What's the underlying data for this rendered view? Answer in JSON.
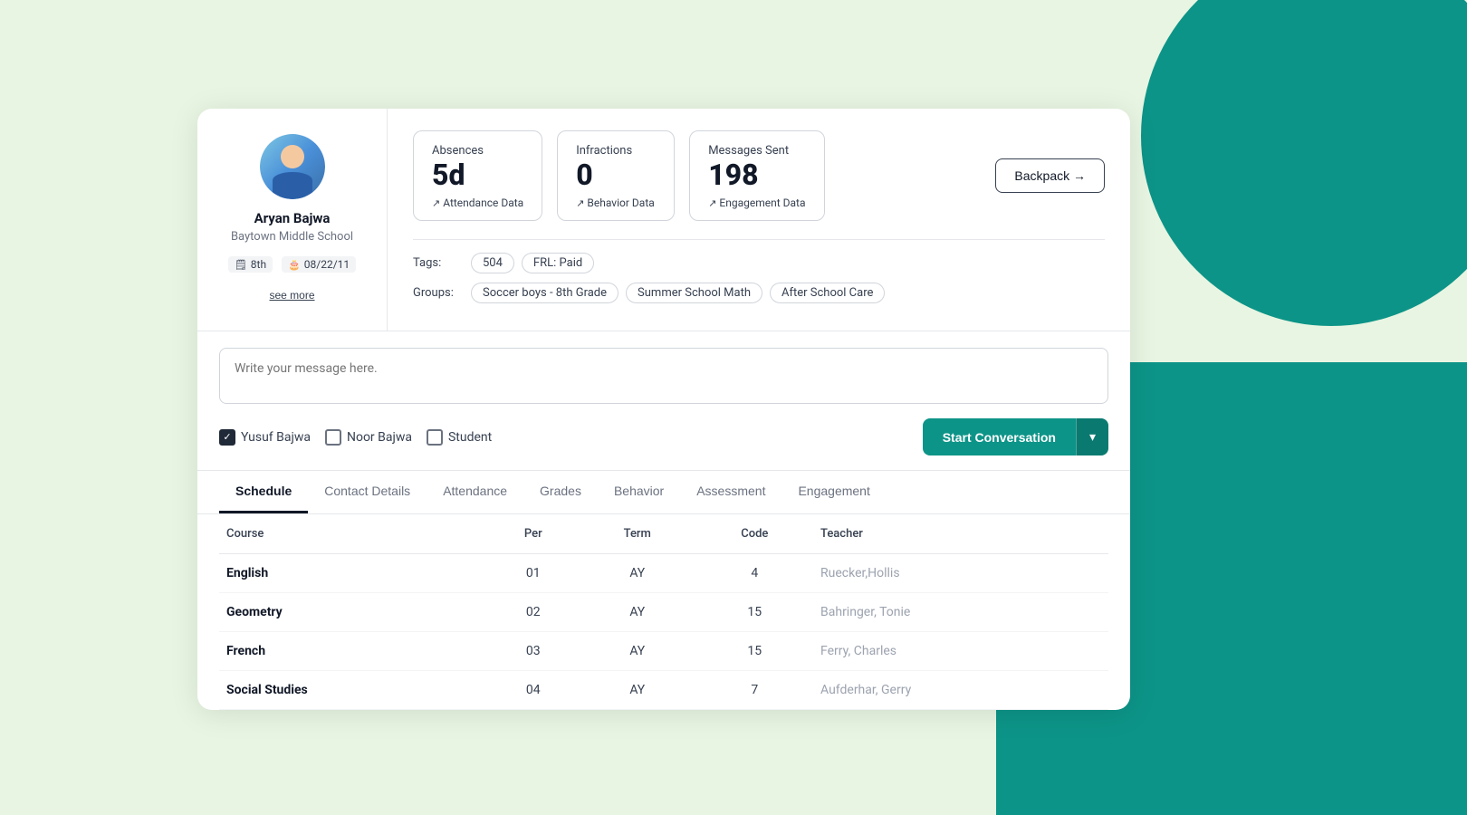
{
  "background": {
    "teal_color": "#0d9488",
    "light_green": "#e8f5e2"
  },
  "student": {
    "name": "Aryan Bajwa",
    "school": "Baytown Middle School",
    "grade": "8th",
    "dob": "08/22/11",
    "see_more_label": "see more"
  },
  "stats": {
    "absences": {
      "label": "Absences",
      "value": "5d",
      "link": "Attendance Data"
    },
    "infractions": {
      "label": "Infractions",
      "value": "0",
      "link": "Behavior Data"
    },
    "messages": {
      "label": "Messages Sent",
      "value": "198",
      "link": "Engagement Data"
    }
  },
  "backpack_button": "Backpack →",
  "tags": {
    "label": "Tags:",
    "items": [
      "504",
      "FRL: Paid"
    ]
  },
  "groups": {
    "label": "Groups:",
    "items": [
      "Soccer boys - 8th Grade",
      "Summer School Math",
      "After School Care"
    ]
  },
  "message": {
    "placeholder": "Write your message here."
  },
  "recipients": [
    {
      "name": "Yusuf Bajwa",
      "checked": true
    },
    {
      "name": "Noor Bajwa",
      "checked": false
    },
    {
      "name": "Student",
      "checked": false
    }
  ],
  "start_conversation_label": "Start Conversation",
  "tabs": [
    {
      "label": "Schedule",
      "active": true
    },
    {
      "label": "Contact Details",
      "active": false
    },
    {
      "label": "Attendance",
      "active": false
    },
    {
      "label": "Grades",
      "active": false
    },
    {
      "label": "Behavior",
      "active": false
    },
    {
      "label": "Assessment",
      "active": false
    },
    {
      "label": "Engagement",
      "active": false
    }
  ],
  "table": {
    "headers": [
      "Course",
      "Per",
      "Term",
      "Code",
      "Teacher"
    ],
    "rows": [
      {
        "course": "English",
        "per": "01",
        "term": "AY",
        "code": "4",
        "teacher": "Ruecker,Hollis"
      },
      {
        "course": "Geometry",
        "per": "02",
        "term": "AY",
        "code": "15",
        "teacher": "Bahringer, Tonie"
      },
      {
        "course": "French",
        "per": "03",
        "term": "AY",
        "code": "15",
        "teacher": "Ferry, Charles"
      },
      {
        "course": "Social Studies",
        "per": "04",
        "term": "AY",
        "code": "7",
        "teacher": "Aufderhar, Gerry"
      }
    ]
  }
}
